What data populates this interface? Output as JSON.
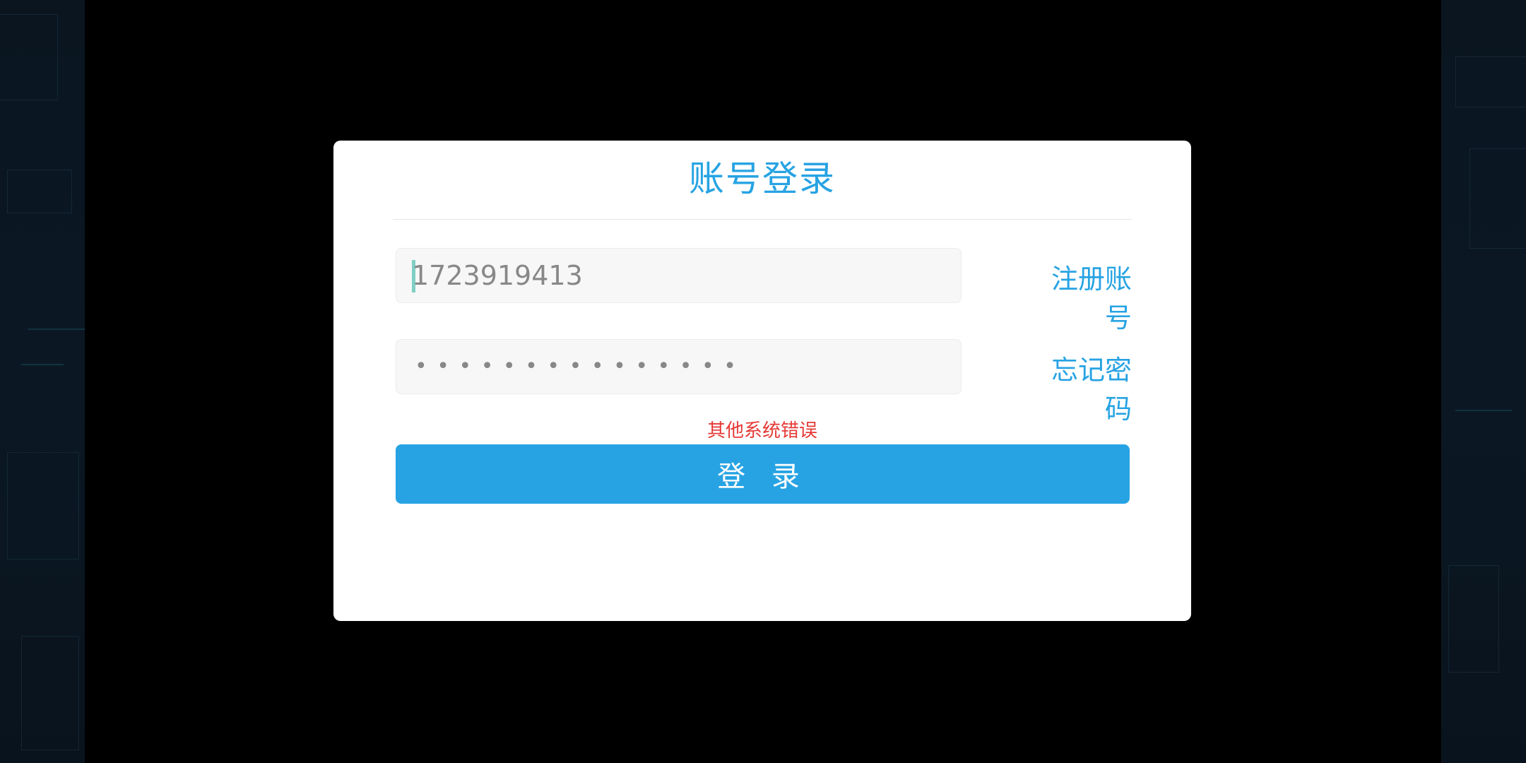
{
  "modal": {
    "title": "账号登录",
    "account_field": {
      "value": "1723919413",
      "placeholder": ""
    },
    "password_field": {
      "masked_value": "• • • • • • • • • • • • • • •"
    },
    "register_link": "注册账号",
    "forgot_link": "忘记密码",
    "error_message": "其他系统错误",
    "login_button": "登 录"
  },
  "colors": {
    "accent": "#27a3e3",
    "error": "#e53935",
    "card": "#ffffff",
    "input_bg": "#f7f7f7",
    "overlay": "#000000"
  }
}
